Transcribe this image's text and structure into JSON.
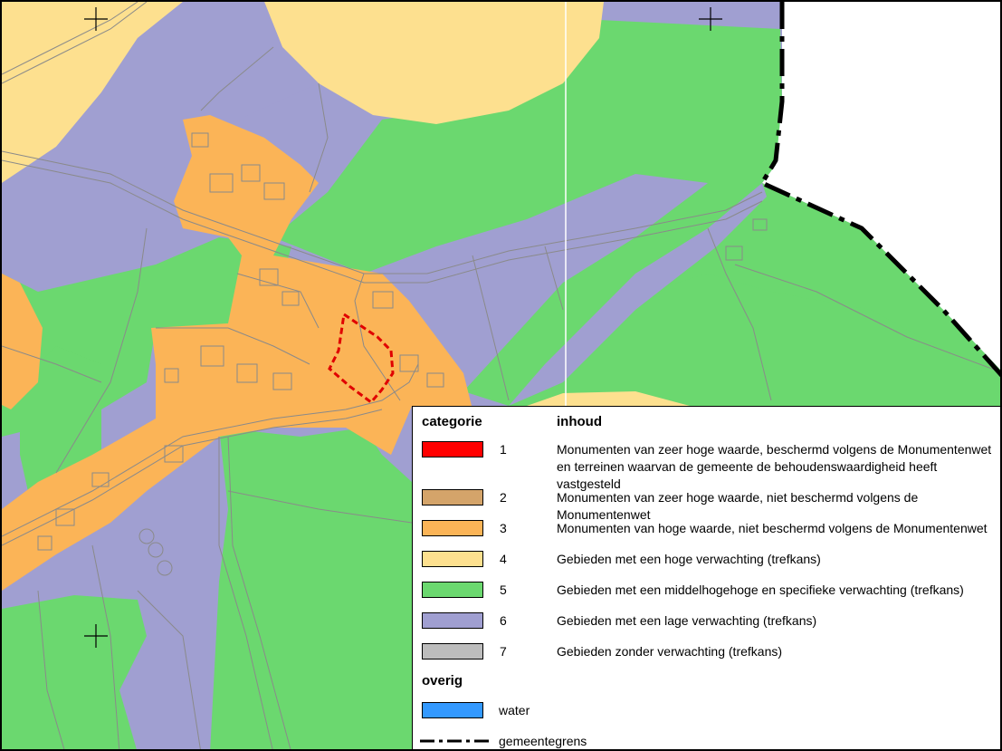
{
  "legend": {
    "header_category": "categorie",
    "header_content": "inhoud",
    "categories": [
      {
        "num": "1",
        "color": "#ff0000",
        "text": "Monumenten van zeer hoge waarde, beschermd volgens de Monumentenwet en terreinen waarvan de gemeente de behoudenswaardigheid heeft vastgesteld"
      },
      {
        "num": "2",
        "color": "#d4a46a",
        "text": "Monumenten van zeer hoge waarde, niet beschermd volgens de Monumentenwet"
      },
      {
        "num": "3",
        "color": "#fbb457",
        "text": "Monumenten van hoge waarde, niet beschermd volgens de Monumentenwet"
      },
      {
        "num": "4",
        "color": "#fde08f",
        "text": "Gebieden met een hoge verwachting (trefkans)"
      },
      {
        "num": "5",
        "color": "#6bd86f",
        "text": "Gebieden met een middelhogehoge en specifieke verwachting (trefkans)"
      },
      {
        "num": "6",
        "color": "#a09fd1",
        "text": "Gebieden met een lage verwachting (trefkans)"
      },
      {
        "num": "7",
        "color": "#bdbdbd",
        "text": "Gebieden zonder verwachting (trefkans)"
      }
    ],
    "other_header": "overig",
    "water_color": "#3399ff",
    "water_label": "water",
    "boundary_label": "gemeentegrens"
  },
  "map_colors": {
    "high": "#fde08f",
    "mid": "#6bd86f",
    "low": "#a09fd1",
    "monument": "#fbb457",
    "protected": "#ff0000"
  }
}
